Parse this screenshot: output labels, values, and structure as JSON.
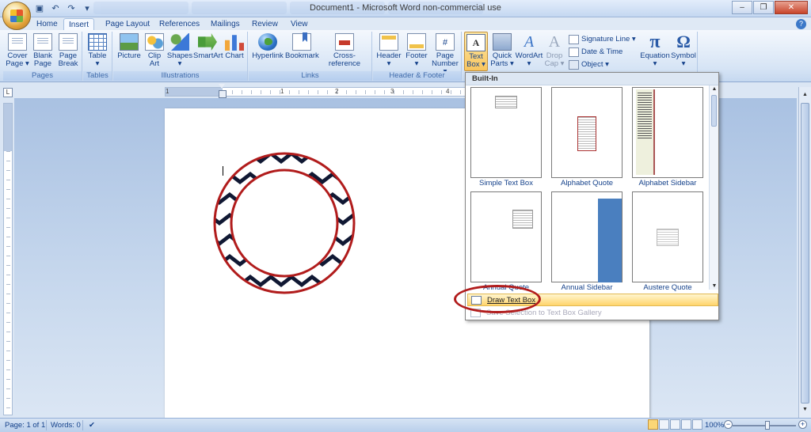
{
  "window": {
    "title": "Document1 - Microsoft Word non-commercial use"
  },
  "tabs": [
    {
      "label": "Home"
    },
    {
      "label": "Insert"
    },
    {
      "label": "Page Layout"
    },
    {
      "label": "References"
    },
    {
      "label": "Mailings"
    },
    {
      "label": "Review"
    },
    {
      "label": "View"
    }
  ],
  "active_tab": "Insert",
  "ribbon": {
    "groups": {
      "pages": "Pages",
      "tables": "Tables",
      "illustrations": "Illustrations",
      "links": "Links",
      "header_footer": "Header & Footer"
    },
    "buttons": {
      "cover_page": [
        "Cover",
        "Page ▾"
      ],
      "blank_page": [
        "Blank",
        "Page"
      ],
      "page_break": [
        "Page",
        "Break"
      ],
      "table": [
        "Table",
        "▾"
      ],
      "picture": [
        "Picture",
        ""
      ],
      "clip_art": [
        "Clip",
        "Art"
      ],
      "shapes": [
        "Shapes",
        "▾"
      ],
      "smartart": [
        "SmartArt",
        ""
      ],
      "chart": [
        "Chart",
        ""
      ],
      "hyperlink": [
        "Hyperlink",
        ""
      ],
      "bookmark": [
        "Bookmark",
        ""
      ],
      "cross_reference": [
        "Cross-reference",
        ""
      ],
      "header": [
        "Header",
        "▾"
      ],
      "footer": [
        "Footer",
        "▾"
      ],
      "page_number": [
        "Page",
        "Number ▾"
      ],
      "text_box": [
        "Text",
        "Box ▾"
      ],
      "quick_parts": [
        "Quick",
        "Parts ▾"
      ],
      "wordart": [
        "WordArt",
        "▾"
      ],
      "drop_cap": [
        "Drop",
        "Cap ▾"
      ],
      "equation": [
        "Equation",
        "▾"
      ],
      "symbol": [
        "Symbol",
        "▾"
      ]
    },
    "small_buttons": {
      "signature_line": "Signature Line ▾",
      "date_time": "Date & Time",
      "object": "Object ▾"
    }
  },
  "ruler": {
    "numbers": [
      "1",
      "1",
      "2",
      "3",
      "4"
    ]
  },
  "gallery": {
    "header": "Built-In",
    "items": [
      {
        "label": "Simple Text Box"
      },
      {
        "label": "Alphabet Quote"
      },
      {
        "label": "Alphabet Sidebar"
      },
      {
        "label": "Annual Quote"
      },
      {
        "label": "Annual Sidebar"
      },
      {
        "label": "Austere Quote"
      }
    ],
    "menu": [
      {
        "label": "Draw Text Box"
      },
      {
        "label": "Save Selection to Text Box Gallery"
      }
    ]
  },
  "statusbar": {
    "page": "Page: 1 of 1",
    "words": "Words: 0",
    "zoom": "100%"
  },
  "colors": {
    "ring_border": "#b11c1c",
    "ring_stripe_dark": "#101833",
    "highlight": "#ffd46b"
  }
}
